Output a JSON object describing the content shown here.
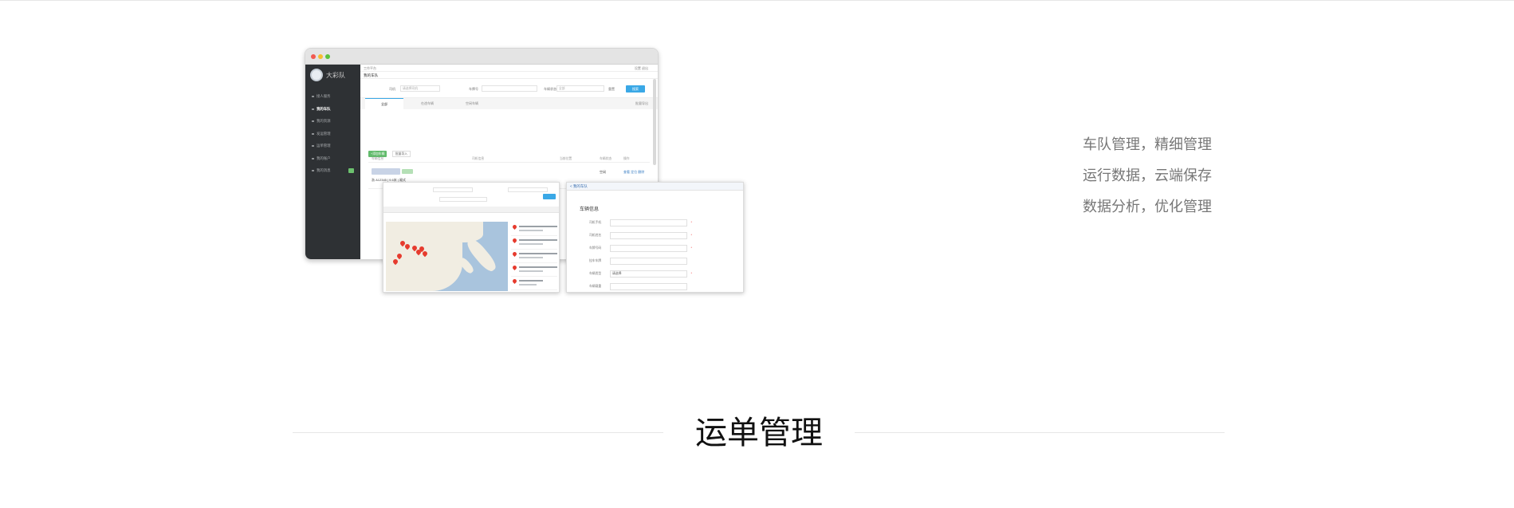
{
  "app": {
    "brand": "大彩队",
    "sidebar": [
      "接人服务",
      "我的车队",
      "我的资源",
      "发运管理",
      "运单管理",
      "我的账户",
      "我的消息"
    ],
    "sidebar_active_index": 1,
    "breadcrumb": "工作平台",
    "header_links": "设置  退出",
    "page_title": "我的车队",
    "filters": {
      "label1": "司机",
      "placeholder1": "请选择司机",
      "label2": "车牌号",
      "label3": "车辆状态",
      "select_value": "全部",
      "reset_label": "重置",
      "search_label": "搜索"
    },
    "tabs": [
      "全部",
      "在途车辆",
      "空闲车辆"
    ],
    "export_label": "批量导出",
    "add_button": "+添加车辆",
    "import_button": "批量导入",
    "columns": [
      "车辆信息",
      "司机信息",
      "当前位置",
      "车辆状态",
      "操作"
    ],
    "row_driver": "浙 A12345 | 9.6米 | 厢式",
    "row_status": "空闲",
    "row_actions": "查看 定位 删除"
  },
  "map_popup": {
    "search_label": "搜索"
  },
  "form_popup": {
    "header": "< 我的车队",
    "title": "车辆信息",
    "fields": [
      {
        "label": "司机手机",
        "value": ""
      },
      {
        "label": "司机姓名",
        "value": ""
      },
      {
        "label": "车牌号码",
        "value": ""
      },
      {
        "label": "挂车车牌",
        "value": ""
      },
      {
        "label": "车辆类型",
        "value": "请选择"
      },
      {
        "label": "车辆载重",
        "value": ""
      }
    ]
  },
  "features": [
    "车队管理，精细管理",
    "运行数据，云端保存",
    "数据分析，优化管理"
  ],
  "section_title": "运单管理",
  "colors": {
    "sidebar_bg": "#2e3134",
    "accent_blue": "#3aa8e6",
    "accent_green": "#62bb6c",
    "marker_red": "#e63b2e",
    "feature_text": "#777777"
  }
}
